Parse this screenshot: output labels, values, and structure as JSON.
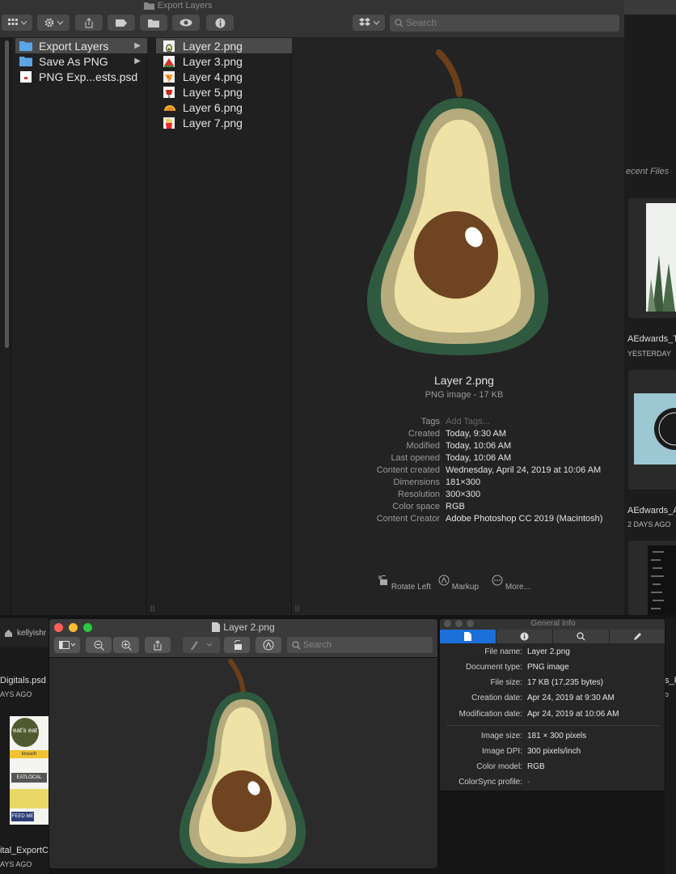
{
  "finder": {
    "title": "Export Layers",
    "search_placeholder": "Search",
    "sidebar": [
      {
        "label": "Export Layers",
        "icon": "folder-icon",
        "selected": true
      },
      {
        "label": "Save As PNG",
        "icon": "folder-icon",
        "selected": false
      },
      {
        "label": "PNG Exp...ests.psd",
        "icon": "psd-file-icon",
        "selected": false
      }
    ],
    "files": [
      {
        "label": "Layer 2.png",
        "icon": "avocado-thumb",
        "selected": true
      },
      {
        "label": "Layer 3.png",
        "icon": "watermelon-thumb",
        "selected": false
      },
      {
        "label": "Layer 4.png",
        "icon": "pizza-thumb",
        "selected": false
      },
      {
        "label": "Layer 5.png",
        "icon": "drink-thumb",
        "selected": false
      },
      {
        "label": "Layer 6.png",
        "icon": "taco-thumb",
        "selected": false
      },
      {
        "label": "Layer 7.png",
        "icon": "fries-thumb",
        "selected": false
      }
    ],
    "preview": {
      "name": "Layer 2.png",
      "kind": "PNG image - 17 KB",
      "meta": [
        {
          "k": "Tags",
          "v": "Add Tags...",
          "muted": true
        },
        {
          "k": "Created",
          "v": "Today, 9:30 AM"
        },
        {
          "k": "Modified",
          "v": "Today, 10:06 AM"
        },
        {
          "k": "Last opened",
          "v": "Today, 10:06 AM"
        },
        {
          "k": "Content created",
          "v": "Wednesday, April 24, 2019 at 10:06 AM"
        },
        {
          "k": "Dimensions",
          "v": "181×300"
        },
        {
          "k": "Resolution",
          "v": "300×300"
        },
        {
          "k": "Color space",
          "v": "RGB"
        },
        {
          "k": "Content Creator",
          "v": "Adobe Photoshop CC 2019 (Macintosh)"
        }
      ],
      "actions": [
        "Rotate Left",
        "Markup",
        "More..."
      ]
    }
  },
  "background_window": {
    "section_title": "ecent Files",
    "items": [
      {
        "name": "AEdwards_T",
        "date": "YESTERDAY"
      },
      {
        "name": "AEdwards_A",
        "date": "2 DAYS AGO"
      }
    ]
  },
  "behind_left": {
    "tab_label": "kellyishr",
    "file1_name": "Digitals.psd",
    "file1_date": "AYS AGO",
    "file2_name": "ital_ExportC",
    "file2_date": "AYS AGO",
    "thumb_text": [
      "eat's eat",
      "kruuch",
      "EATLOCAL",
      "FEED ME"
    ]
  },
  "behind_right_fragment": {
    "text1": "s_F",
    "text2": "o"
  },
  "preview_window": {
    "title": "Layer 2.png",
    "search_placeholder": "Search"
  },
  "info_panel": {
    "title": "General Info",
    "rows": [
      {
        "k": "File name:",
        "v": "Layer 2.png"
      },
      {
        "k": "Document type:",
        "v": "PNG image"
      },
      {
        "k": "File size:",
        "v": "17 KB (17,235 bytes)"
      },
      {
        "k": "Creation date:",
        "v": "Apr 24, 2019 at 9:30 AM"
      },
      {
        "k": "Modification date:",
        "v": "Apr 24, 2019 at 10:06 AM"
      },
      {
        "k": "Image size:",
        "v": "181 × 300 pixels"
      },
      {
        "k": "Image DPI:",
        "v": "300 pixels/inch"
      },
      {
        "k": "Color model:",
        "v": "RGB"
      },
      {
        "k": "ColorSync profile:",
        "v": "-"
      }
    ]
  },
  "colors": {
    "avocado_skin": "#2f5a40",
    "avocado_rim": "#b5ab7c",
    "avocado_flesh": "#efe2a6",
    "avocado_pit": "#6f4420",
    "stem": "#6a3f19",
    "selection_blue": "#1c6fd8"
  }
}
